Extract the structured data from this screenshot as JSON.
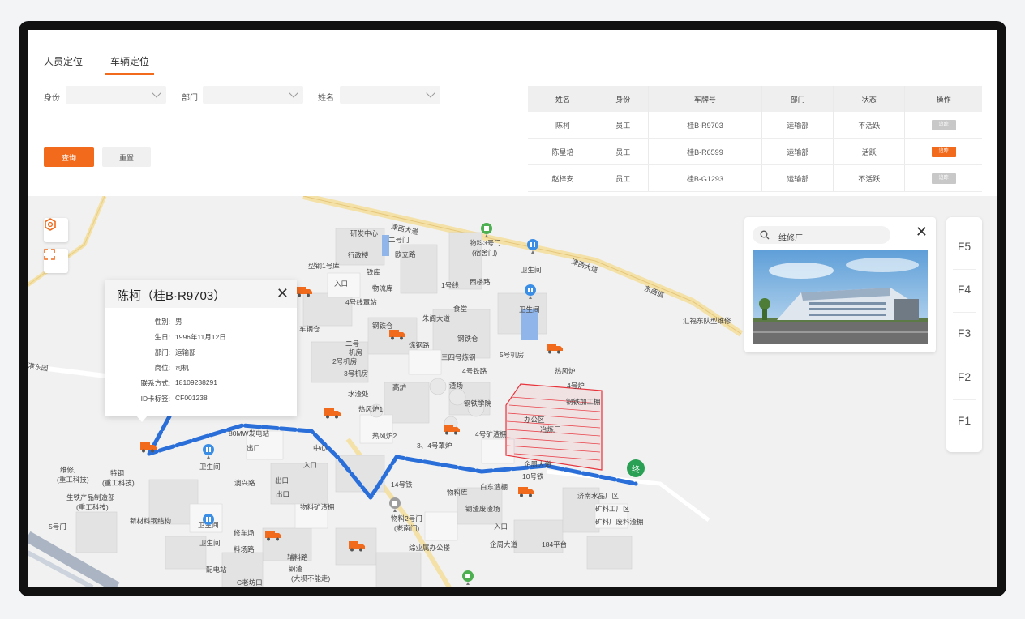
{
  "tabs": [
    {
      "label": "人员定位"
    },
    {
      "label": "车辆定位"
    }
  ],
  "filters": {
    "identity_label": "身份",
    "department_label": "部门",
    "name_label": "姓名"
  },
  "buttons": {
    "query": "查询",
    "reset": "重置"
  },
  "table": {
    "headers": [
      "姓名",
      "身份",
      "车牌号",
      "部门",
      "状态",
      "操作"
    ],
    "rows": [
      {
        "name": "陈柯",
        "identity": "员工",
        "plate": "桂B-R9703",
        "dept": "运输部",
        "status": "不活跃",
        "op": "追踪",
        "op_color": "#c8c8c8"
      },
      {
        "name": "陈星培",
        "identity": "员工",
        "plate": "桂B-R6599",
        "dept": "运输部",
        "status": "活跃",
        "op": "追踪",
        "op_color": "#f26b1d"
      },
      {
        "name": "赵梓安",
        "identity": "员工",
        "plate": "桂B-G1293",
        "dept": "运输部",
        "status": "不活跃",
        "op": "追踪",
        "op_color": "#c8c8c8"
      }
    ]
  },
  "popup": {
    "title": "陈柯（桂B·R9703）",
    "fields": [
      {
        "k": "性别:",
        "v": "男"
      },
      {
        "k": "生日:",
        "v": "1996年11月12日"
      },
      {
        "k": "部门:",
        "v": "运输部"
      },
      {
        "k": "岗位:",
        "v": "司机"
      },
      {
        "k": "联系方式:",
        "v": "18109238291"
      },
      {
        "k": "ID卡标签:",
        "v": "CF001238"
      }
    ]
  },
  "search": {
    "value": "维修厂"
  },
  "floors": [
    "F5",
    "F4",
    "F3",
    "F2",
    "F1"
  ],
  "map": {
    "end_marker": "终",
    "labels": {
      "l1": "研发中心",
      "l2": "二号门",
      "l3": "物料3号门",
      "l4": "(宿舍门)",
      "l5": "行政楼",
      "l6": "欧立路",
      "l7": "型钢1号库",
      "l8": "铁库",
      "l9": "入口",
      "l10": "物流库",
      "l11": "1号线",
      "l12": "西楼路",
      "l13": "卫生间",
      "l14": "卫生间",
      "l15": "4号线罩站",
      "l16": "食堂",
      "l17": "朱阁大道",
      "l18": "钢铁仓",
      "l19": "车辆仓",
      "l20": "2号机房",
      "l21": "炼钢路",
      "l22": "钢铁仓",
      "l23": "二号",
      "l24": "机房",
      "l25": "3号机房",
      "l26": "三四号炼钢",
      "l27": "5号机房",
      "l28": "4号铁路",
      "l29": "4号炉",
      "l30": "水渣处",
      "l31": "热风炉1",
      "l32": "高炉",
      "l33": "渣场",
      "l34": "钢铁加工棚",
      "l35": "卫生间",
      "l36": "80MW发电站",
      "l37": "出口",
      "l38": "热风炉2",
      "l39": "3、4号罩炉",
      "l40": "4号矿渣棚",
      "l41": "中心",
      "l42": "入口",
      "l43": "出口",
      "l44": "出口",
      "l45": "卫生间",
      "l46": "澳兴路",
      "l47": "维修厂",
      "l48": "特钢",
      "l49": "(重工科技)",
      "l50": "(重工科技)",
      "l51": "生铁产品制造部",
      "l52": "(重工科技)",
      "l53": "5号门",
      "l54": "新材料钢结构",
      "l55": "卫生间",
      "l56": "物料矿渣棚",
      "l57": "14号铁",
      "l58": "物料库",
      "l59": "白东渣棚",
      "l60": "10号铁",
      "l61": "企周大道",
      "l62": "济南水晶厂区",
      "l63": "矿料工厂区",
      "l64": "矿料厂废料渣棚",
      "l65": "物料2号门",
      "l66": "(老南门)",
      "l67": "入口",
      "l68": "钢渣废渣场",
      "l69": "综业属办公楼",
      "l70": "企周大道",
      "l71": "184平台",
      "l72": "修车场",
      "l73": "料场路",
      "l74": "配电站",
      "l75": "辅料路",
      "l76": "钢渣",
      "l77": "C老坊口",
      "l78": "(大坝不能走)",
      "l79": "汇福东队型维修",
      "l80": "津西大道",
      "l81": "津西大道",
      "l82": "港东园",
      "l83": "东西道",
      "l84": "办公区",
      "l85": "冶炼厂",
      "l86": "热风炉",
      "l87": "钢铁学院"
    }
  },
  "colors": {
    "accent": "#f26b1d",
    "route": "#2a6fd9",
    "zone": "#e8333b",
    "end_marker": "#2aa055"
  }
}
